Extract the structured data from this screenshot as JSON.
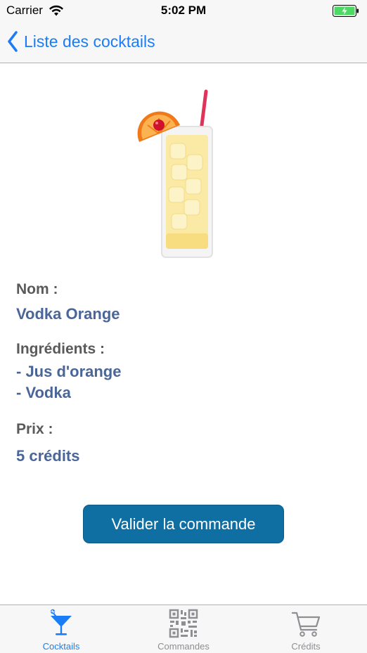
{
  "status_bar": {
    "carrier": "Carrier",
    "time": "5:02 PM"
  },
  "nav": {
    "back_label": "Liste des cocktails"
  },
  "cocktail": {
    "name_label": "Nom :",
    "name": "Vodka Orange",
    "ingredients_label": "Ingrédients :",
    "ingredients": [
      "- Jus d'orange",
      "- Vodka"
    ],
    "price_label": "Prix :",
    "price": "5 crédits"
  },
  "actions": {
    "validate_label": "Valider la commande"
  },
  "tab_bar": {
    "items": [
      {
        "label": "Cocktails",
        "icon": "cocktail-icon",
        "active": true
      },
      {
        "label": "Commandes",
        "icon": "qr-code-icon",
        "active": false
      },
      {
        "label": "Crédits",
        "icon": "cart-icon",
        "active": false
      }
    ]
  },
  "colors": {
    "accent": "#1a7df5",
    "value_text": "#4a6699",
    "label_text": "#5a5a5a",
    "button_bg": "#0f6fa3",
    "tab_inactive": "#8e8e93"
  }
}
